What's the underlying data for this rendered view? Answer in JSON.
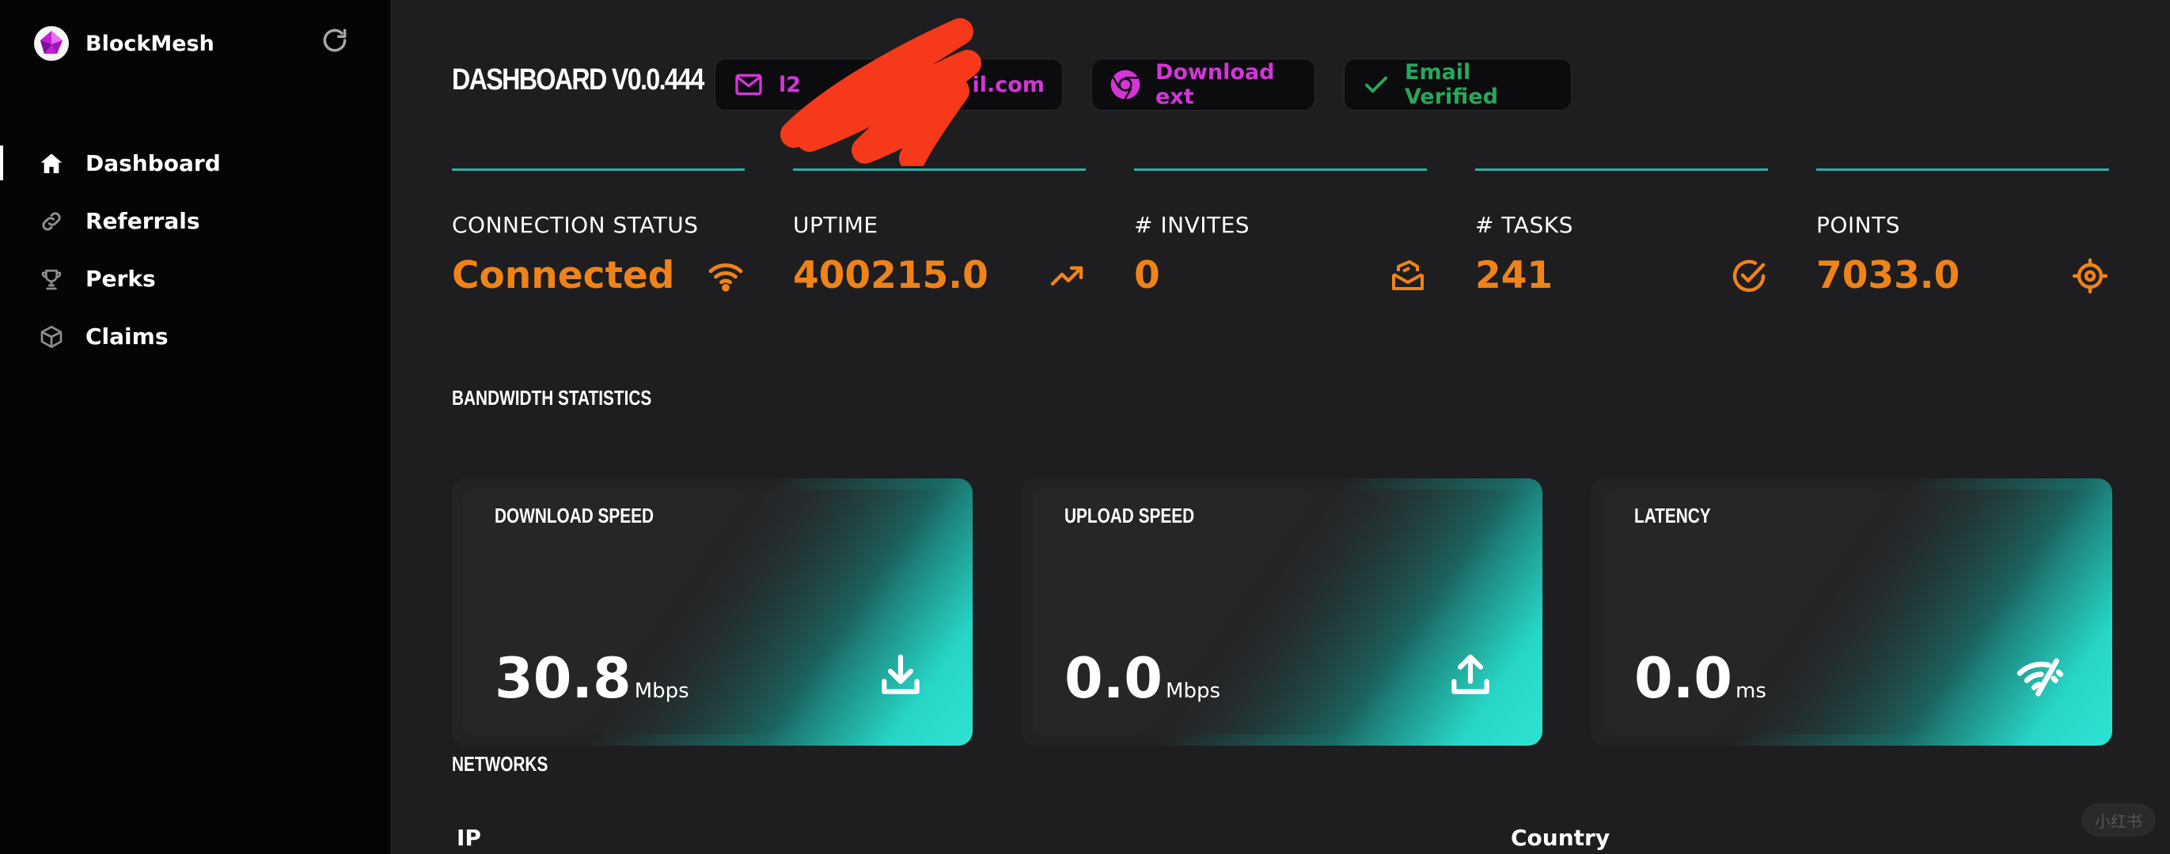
{
  "sidebar": {
    "brand": "BlockMesh",
    "items": [
      {
        "label": "Dashboard",
        "active": true
      },
      {
        "label": "Referrals",
        "active": false
      },
      {
        "label": "Perks",
        "active": false
      },
      {
        "label": "Claims",
        "active": false
      }
    ]
  },
  "header": {
    "title": "DASHBOARD V0.0.444",
    "email_visible": "l2 ... il.com",
    "email_prefix": "l2",
    "email_suffix": "il.com",
    "download_label": "Download ext",
    "verified_label": "Email Verified"
  },
  "stats": [
    {
      "label": "CONNECTION STATUS",
      "value": "Connected",
      "icon": "wifi-icon"
    },
    {
      "label": "UPTIME",
      "value": "400215.0",
      "icon": "trending-up-icon"
    },
    {
      "label": "# INVITES",
      "value": "0",
      "icon": "mail-stack-icon"
    },
    {
      "label": "# TASKS",
      "value": "241",
      "icon": "check-circle-icon"
    },
    {
      "label": "POINTS",
      "value": "7033.0",
      "icon": "target-icon"
    }
  ],
  "bandwidth": {
    "title": "BANDWIDTH STATISTICS",
    "cards": [
      {
        "title": "DOWNLOAD SPEED",
        "value": "30.8",
        "unit": "Mbps",
        "icon": "download-icon"
      },
      {
        "title": "UPLOAD SPEED",
        "value": "0.0",
        "unit": "Mbps",
        "icon": "upload-icon"
      },
      {
        "title": "LATENCY",
        "value": "0.0",
        "unit": "ms",
        "icon": "signal-off-icon"
      }
    ]
  },
  "networks": {
    "title": "NETWORKS",
    "columns": [
      "IP",
      "Country"
    ]
  },
  "watermark": "小红书",
  "colors": {
    "accent_orange": "#f08318",
    "accent_teal": "#2ee3d3",
    "accent_magenta": "#d535d8",
    "accent_green": "#26a85a"
  }
}
